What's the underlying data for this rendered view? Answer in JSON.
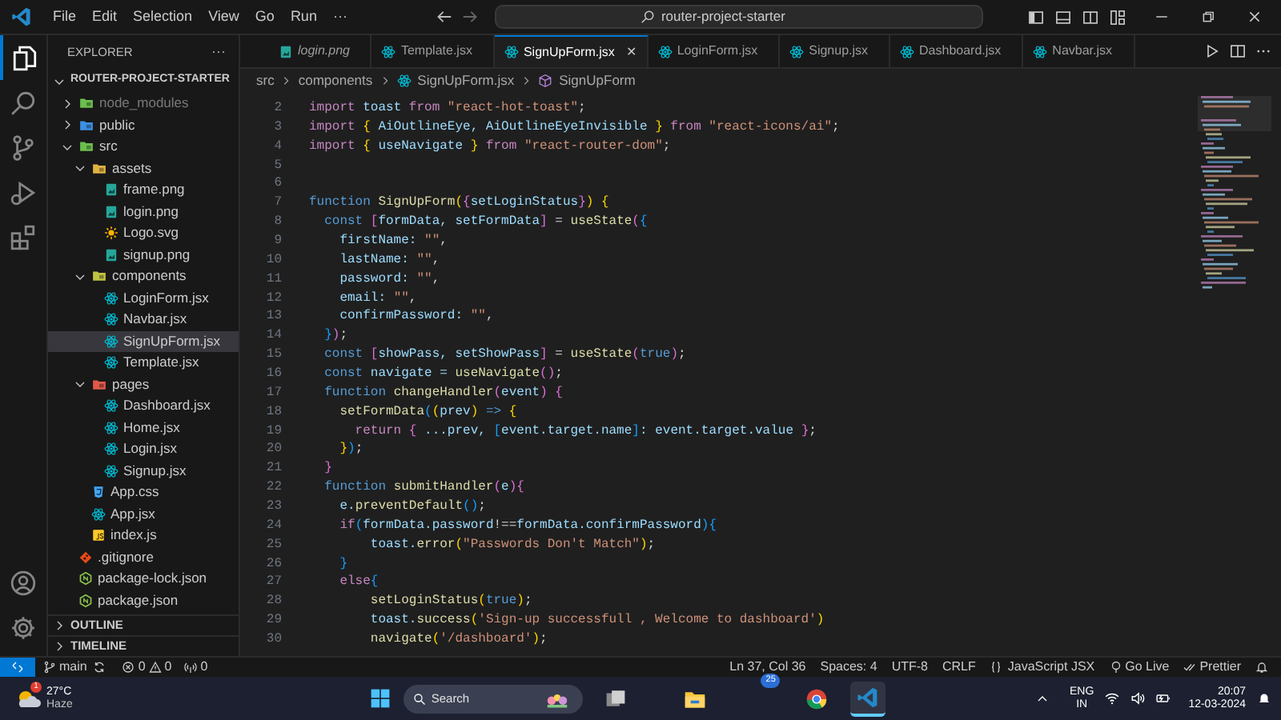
{
  "title_bar": {
    "menu": [
      "File",
      "Edit",
      "Selection",
      "View",
      "Go",
      "Run",
      "···"
    ],
    "command_center": "router-project-starter"
  },
  "sidebar": {
    "title": "EXPLORER",
    "more": "···",
    "project": "ROUTER-PROJECT-STARTER",
    "project_expanded": true,
    "tree": [
      {
        "label": "node_modules",
        "kind": "folder",
        "color": "#6bbf4e",
        "expanded": false,
        "selected": false,
        "dimmed": true
      },
      {
        "label": "public",
        "kind": "folder",
        "color": "#3d8fe0",
        "expanded": false,
        "selected": false,
        "dimmed": false
      },
      {
        "label": "src",
        "kind": "folder",
        "color": "#6bbf4e",
        "expanded": true,
        "selected": false,
        "dimmed": false,
        "children": [
          {
            "label": "assets",
            "kind": "folder",
            "color": "#e0b341",
            "expanded": true,
            "selected": false,
            "dimmed": false,
            "children": [
              {
                "label": "frame.png",
                "kind": "image",
                "selected": false,
                "dimmed": false
              },
              {
                "label": "login.png",
                "kind": "image",
                "selected": false,
                "dimmed": false
              },
              {
                "label": "Logo.svg",
                "kind": "svg",
                "selected": false,
                "dimmed": false
              },
              {
                "label": "signup.png",
                "kind": "image",
                "selected": false,
                "dimmed": false
              }
            ]
          },
          {
            "label": "components",
            "kind": "folder",
            "color": "#c0c341",
            "expanded": true,
            "selected": false,
            "dimmed": false,
            "children": [
              {
                "label": "LoginForm.jsx",
                "kind": "react",
                "selected": false,
                "dimmed": false
              },
              {
                "label": "Navbar.jsx",
                "kind": "react",
                "selected": false,
                "dimmed": false
              },
              {
                "label": "SignUpForm.jsx",
                "kind": "react",
                "selected": true,
                "dimmed": false
              },
              {
                "label": "Template.jsx",
                "kind": "react",
                "selected": false,
                "dimmed": false
              }
            ]
          },
          {
            "label": "pages",
            "kind": "folder",
            "color": "#e0584a",
            "expanded": true,
            "selected": false,
            "dimmed": false,
            "children": [
              {
                "label": "Dashboard.jsx",
                "kind": "react",
                "selected": false,
                "dimmed": false
              },
              {
                "label": "Home.jsx",
                "kind": "react",
                "selected": false,
                "dimmed": false
              },
              {
                "label": "Login.jsx",
                "kind": "react",
                "selected": false,
                "dimmed": false
              },
              {
                "label": "Signup.jsx",
                "kind": "react",
                "selected": false,
                "dimmed": false
              }
            ]
          },
          {
            "label": "App.css",
            "kind": "css",
            "selected": false,
            "dimmed": false
          },
          {
            "label": "App.jsx",
            "kind": "react",
            "selected": false,
            "dimmed": false
          },
          {
            "label": "index.js",
            "kind": "js",
            "selected": false,
            "dimmed": false
          }
        ]
      },
      {
        "label": ".gitignore",
        "kind": "git",
        "selected": false,
        "dimmed": false
      },
      {
        "label": "package-lock.json",
        "kind": "npm",
        "selected": false,
        "dimmed": false
      },
      {
        "label": "package.json",
        "kind": "npm",
        "selected": false,
        "dimmed": false
      }
    ],
    "sections": [
      {
        "label": "OUTLINE",
        "expanded": false
      },
      {
        "label": "TIMELINE",
        "expanded": false
      }
    ]
  },
  "tabs": [
    {
      "label": "login.png",
      "kind": "image",
      "preview": true,
      "selected": false
    },
    {
      "label": "Template.jsx",
      "kind": "react",
      "preview": false,
      "selected": false
    },
    {
      "label": "SignUpForm.jsx",
      "kind": "react",
      "preview": false,
      "selected": true
    },
    {
      "label": "LoginForm.jsx",
      "kind": "react",
      "preview": false,
      "selected": false
    },
    {
      "label": "Signup.jsx",
      "kind": "react",
      "preview": false,
      "selected": false
    },
    {
      "label": "Dashboard.jsx",
      "kind": "react",
      "preview": false,
      "selected": false
    },
    {
      "label": "Navbar.jsx",
      "kind": "react",
      "preview": false,
      "selected": false
    }
  ],
  "tab_close": "✕",
  "breadcrumb": [
    {
      "label": "src",
      "kind": "text"
    },
    {
      "label": "components",
      "kind": "text"
    },
    {
      "label": "SignUpForm.jsx",
      "kind": "react"
    },
    {
      "label": "SignUpForm",
      "kind": "symbol"
    }
  ],
  "code": [
    {
      "number": "2",
      "tokens": [
        {
          "text": "import",
          "kind": "kw"
        },
        {
          "text": " toast ",
          "kind": "var"
        },
        {
          "text": "from",
          "kind": "kw"
        },
        {
          "text": " \"react-hot-toast\"",
          "kind": "str"
        },
        {
          "text": ";",
          "kind": "p"
        }
      ]
    },
    {
      "number": "3",
      "tokens": [
        {
          "text": "import",
          "kind": "kw"
        },
        {
          "text": " {",
          "kind": "b1"
        },
        {
          "text": " AiOutlineEye, AiOutlineEyeInvisible ",
          "kind": "var"
        },
        {
          "text": "} ",
          "kind": "b1"
        },
        {
          "text": "from",
          "kind": "kw"
        },
        {
          "text": " \"react-icons/ai\"",
          "kind": "str"
        },
        {
          "text": ";",
          "kind": "p"
        }
      ]
    },
    {
      "number": "4",
      "tokens": [
        {
          "text": "import",
          "kind": "kw"
        },
        {
          "text": " {",
          "kind": "b1"
        },
        {
          "text": " useNavigate ",
          "kind": "var"
        },
        {
          "text": "} ",
          "kind": "b1"
        },
        {
          "text": "from",
          "kind": "kw"
        },
        {
          "text": " \"react-router-dom\"",
          "kind": "str"
        },
        {
          "text": ";",
          "kind": "p"
        }
      ]
    },
    {
      "number": "5"
    },
    {
      "number": "6"
    },
    {
      "number": "7",
      "tokens": [
        {
          "text": "function",
          "kind": "decl"
        },
        {
          "text": " SignUpForm",
          "kind": "fn"
        },
        {
          "text": "(",
          "kind": "b1"
        },
        {
          "text": "{",
          "kind": "b2"
        },
        {
          "text": "setLoginStatus",
          "kind": "var"
        },
        {
          "text": "}",
          "kind": "b2"
        },
        {
          "text": ")",
          "kind": "b1"
        },
        {
          "text": " {",
          "kind": "b1"
        }
      ]
    },
    {
      "number": "8",
      "tokens": [
        {
          "text": "  const",
          "kind": "decl"
        },
        {
          "text": " [",
          "kind": "b2"
        },
        {
          "text": "formData, setFormData",
          "kind": "var"
        },
        {
          "text": "]",
          "kind": "b2"
        },
        {
          "text": " = ",
          "kind": "p"
        },
        {
          "text": "useState",
          "kind": "fn"
        },
        {
          "text": "(",
          "kind": "b2"
        },
        {
          "text": "{",
          "kind": "b3"
        }
      ]
    },
    {
      "number": "9",
      "tokens": [
        {
          "text": "    firstName: ",
          "kind": "var"
        },
        {
          "text": "\"\"",
          "kind": "str"
        },
        {
          "text": ",",
          "kind": "p"
        }
      ]
    },
    {
      "number": "10",
      "tokens": [
        {
          "text": "    lastName: ",
          "kind": "var"
        },
        {
          "text": "\"\"",
          "kind": "str"
        },
        {
          "text": ",",
          "kind": "p"
        }
      ]
    },
    {
      "number": "11",
      "tokens": [
        {
          "text": "    password: ",
          "kind": "var"
        },
        {
          "text": "\"\"",
          "kind": "str"
        },
        {
          "text": ",",
          "kind": "p"
        }
      ]
    },
    {
      "number": "12",
      "tokens": [
        {
          "text": "    email: ",
          "kind": "var"
        },
        {
          "text": "\"\"",
          "kind": "str"
        },
        {
          "text": ",",
          "kind": "p"
        }
      ]
    },
    {
      "number": "13",
      "tokens": [
        {
          "text": "    confirmPassword: ",
          "kind": "var"
        },
        {
          "text": "\"\"",
          "kind": "str"
        },
        {
          "text": ",",
          "kind": "p"
        }
      ]
    },
    {
      "number": "14",
      "tokens": [
        {
          "text": "  }",
          "kind": "b3"
        },
        {
          "text": ")",
          "kind": "b2"
        },
        {
          "text": ";",
          "kind": "p"
        }
      ]
    },
    {
      "number": "15",
      "tokens": [
        {
          "text": "  const",
          "kind": "decl"
        },
        {
          "text": " [",
          "kind": "b2"
        },
        {
          "text": "showPass, setShowPass",
          "kind": "var"
        },
        {
          "text": "]",
          "kind": "b2"
        },
        {
          "text": " = ",
          "kind": "p"
        },
        {
          "text": "useState",
          "kind": "fn"
        },
        {
          "text": "(",
          "kind": "b2"
        },
        {
          "text": "true",
          "kind": "lit"
        },
        {
          "text": ")",
          "kind": "b2"
        },
        {
          "text": ";",
          "kind": "p"
        }
      ]
    },
    {
      "number": "16",
      "tokens": [
        {
          "text": "  const",
          "kind": "decl"
        },
        {
          "text": " navigate = ",
          "kind": "var"
        },
        {
          "text": "useNavigate",
          "kind": "fn"
        },
        {
          "text": "()",
          "kind": "b2"
        },
        {
          "text": ";",
          "kind": "p"
        }
      ]
    },
    {
      "number": "17",
      "tokens": [
        {
          "text": "  function",
          "kind": "decl"
        },
        {
          "text": " changeHandler",
          "kind": "fn"
        },
        {
          "text": "(",
          "kind": "b2"
        },
        {
          "text": "event",
          "kind": "var"
        },
        {
          "text": ")",
          "kind": "b2"
        },
        {
          "text": " {",
          "kind": "b2"
        }
      ]
    },
    {
      "number": "18",
      "tokens": [
        {
          "text": "    setFormData",
          "kind": "fn"
        },
        {
          "text": "(",
          "kind": "b3"
        },
        {
          "text": "(",
          "kind": "b1"
        },
        {
          "text": "prev",
          "kind": "var"
        },
        {
          "text": ")",
          "kind": "b1"
        },
        {
          "text": " =>",
          "kind": "decl"
        },
        {
          "text": " {",
          "kind": "b1"
        }
      ]
    },
    {
      "number": "19",
      "tokens": [
        {
          "text": "      return",
          "kind": "kw"
        },
        {
          "text": " {",
          "kind": "b2"
        },
        {
          "text": " ...prev, ",
          "kind": "var"
        },
        {
          "text": "[",
          "kind": "b3"
        },
        {
          "text": "event.target.name",
          "kind": "var"
        },
        {
          "text": "]",
          "kind": "b3"
        },
        {
          "text": ": event.target.value ",
          "kind": "var"
        },
        {
          "text": "}",
          "kind": "b2"
        },
        {
          "text": ";",
          "kind": "p"
        }
      ]
    },
    {
      "number": "20",
      "tokens": [
        {
          "text": "    }",
          "kind": "b1"
        },
        {
          "text": ")",
          "kind": "b3"
        },
        {
          "text": ";",
          "kind": "p"
        }
      ]
    },
    {
      "number": "21",
      "tokens": [
        {
          "text": "  }",
          "kind": "b2"
        }
      ]
    },
    {
      "number": "22",
      "tokens": [
        {
          "text": "  function",
          "kind": "decl"
        },
        {
          "text": " submitHandler",
          "kind": "fn"
        },
        {
          "text": "(",
          "kind": "b2"
        },
        {
          "text": "e",
          "kind": "var"
        },
        {
          "text": ")",
          "kind": "b2"
        },
        {
          "text": "{",
          "kind": "b2"
        }
      ]
    },
    {
      "number": "23",
      "tokens": [
        {
          "text": "    e.",
          "kind": "var"
        },
        {
          "text": "preventDefault",
          "kind": "fn"
        },
        {
          "text": "()",
          "kind": "b3"
        },
        {
          "text": ";",
          "kind": "p"
        }
      ]
    },
    {
      "number": "24",
      "tokens": [
        {
          "text": "    if",
          "kind": "kw"
        },
        {
          "text": "(",
          "kind": "b3"
        },
        {
          "text": "formData.password",
          "kind": "var"
        },
        {
          "text": "!==",
          "kind": "p"
        },
        {
          "text": "formData.confirmPassword",
          "kind": "var"
        },
        {
          "text": ")",
          "kind": "b3"
        },
        {
          "text": "{",
          "kind": "b3"
        }
      ]
    },
    {
      "number": "25",
      "tokens": [
        {
          "text": "        toast.",
          "kind": "var"
        },
        {
          "text": "error",
          "kind": "fn"
        },
        {
          "text": "(",
          "kind": "b1"
        },
        {
          "text": "\"Passwords Don't Match\"",
          "kind": "str"
        },
        {
          "text": ")",
          "kind": "b1"
        },
        {
          "text": ";",
          "kind": "p"
        }
      ]
    },
    {
      "number": "26",
      "tokens": [
        {
          "text": "    }",
          "kind": "b3"
        }
      ]
    },
    {
      "number": "27",
      "tokens": [
        {
          "text": "    else",
          "kind": "kw"
        },
        {
          "text": "{",
          "kind": "b3"
        }
      ]
    },
    {
      "number": "28",
      "tokens": [
        {
          "text": "        setLoginStatus",
          "kind": "fn"
        },
        {
          "text": "(",
          "kind": "b1"
        },
        {
          "text": "true",
          "kind": "lit"
        },
        {
          "text": ")",
          "kind": "b1"
        },
        {
          "text": ";",
          "kind": "p"
        }
      ]
    },
    {
      "number": "29",
      "tokens": [
        {
          "text": "        toast.",
          "kind": "var"
        },
        {
          "text": "success",
          "kind": "fn"
        },
        {
          "text": "(",
          "kind": "b1"
        },
        {
          "text": "'Sign-up successfull , Welcome to dashboard'",
          "kind": "str"
        },
        {
          "text": ")",
          "kind": "b1"
        }
      ]
    },
    {
      "number": "30",
      "tokens": [
        {
          "text": "        navigate",
          "kind": "fn"
        },
        {
          "text": "(",
          "kind": "b1"
        },
        {
          "text": "'/dashboard'",
          "kind": "str"
        },
        {
          "text": ")",
          "kind": "b1"
        },
        {
          "text": ";",
          "kind": "p"
        }
      ]
    }
  ],
  "status_bar": {
    "branch": "main",
    "errors": "0",
    "warnings": "0",
    "ports": "0",
    "cursor": "Ln 37, Col 36",
    "spaces": "Spaces: 4",
    "encoding": "UTF-8",
    "eol": "CRLF",
    "language": "JavaScript JSX",
    "go_live": "Go Live",
    "prettier": "Prettier"
  },
  "taskbar": {
    "weather_badge": "1",
    "temperature": "27°C",
    "condition": "Haze",
    "search_placeholder": "Search",
    "app_badge": "25",
    "language": "ENG",
    "region": "IN",
    "time": "20:07",
    "date": "12-03-2024"
  }
}
